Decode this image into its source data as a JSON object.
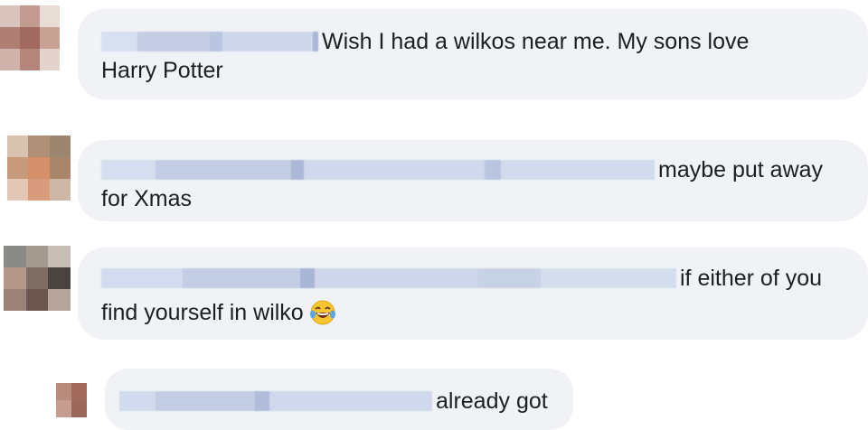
{
  "comments": [
    {
      "author_label": "",
      "text_line1": "Wish I had a wilkos near me. My sons love",
      "text_line2": "Harry Potter",
      "avatar_icon": "blurred-avatar-icon"
    },
    {
      "author_label": "",
      "text_line1": "maybe put away",
      "text_line2": "for Xmas",
      "avatar_icon": "blurred-avatar-icon"
    },
    {
      "author_label": "",
      "text_line1": "if either of you",
      "text_line2": "find yourself in wilko",
      "emoji": "laughing-crying-emoji-icon",
      "avatar_icon": "blurred-avatar-icon"
    },
    {
      "author_label": "",
      "text_line1": "already got",
      "avatar_icon": "blurred-avatar-icon",
      "is_reply": true
    }
  ],
  "colors": {
    "bubble": "#f0f2f5",
    "text": "#1c1e21",
    "blur": "#c9d3e6"
  }
}
